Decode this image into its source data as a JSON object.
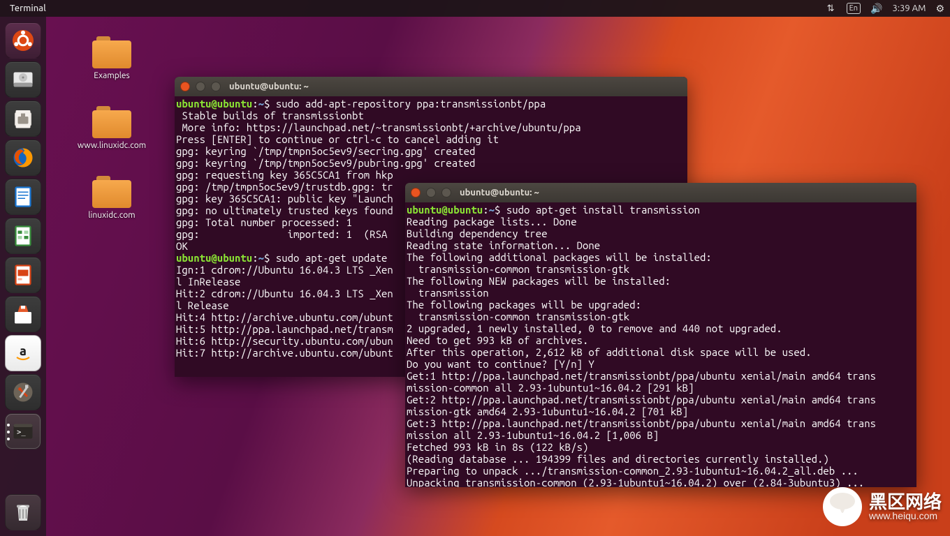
{
  "panel": {
    "app_title": "Terminal",
    "lang": "En",
    "time": "3:39 AM"
  },
  "desktop": {
    "icon1": "Examples",
    "icon2": "www.linuxidc.com",
    "icon3": "linuxidc.com"
  },
  "term1": {
    "title": "ubuntu@ubuntu: ~",
    "prompt_user": "ubuntu@ubuntu",
    "prompt_path": "~",
    "cmd1": "sudo add-apt-repository ppa:transmissionbt/ppa",
    "l1": " Stable builds of transmissionbt",
    "l2": " More info: https://launchpad.net/~transmissionbt/+archive/ubuntu/ppa",
    "l3": "Press [ENTER] to continue or ctrl-c to cancel adding it",
    "l4": "",
    "l5": "gpg: keyring `/tmp/tmpn5oc5ev9/secring.gpg' created",
    "l6": "gpg: keyring `/tmp/tmpn5oc5ev9/pubring.gpg' created",
    "l7": "gpg: requesting key 365C5CA1 from hkp",
    "l8": "gpg: /tmp/tmpn5oc5ev9/trustdb.gpg: tr",
    "l9": "gpg: key 365C5CA1: public key \"Launch",
    "l10": "gpg: no ultimately trusted keys found",
    "l11": "gpg: Total number processed: 1",
    "l12": "gpg:               imported: 1  (RSA",
    "l13": "OK",
    "cmd2": "sudo apt-get update",
    "l14": "Ign:1 cdrom://Ubuntu 16.04.3 LTS _Xen",
    "l15": "l InRelease",
    "l16": "Hit:2 cdrom://Ubuntu 16.04.3 LTS _Xen",
    "l17": "l Release",
    "l18": "Hit:4 http://archive.ubuntu.com/ubunt",
    "l19": "Hit:5 http://ppa.launchpad.net/transm",
    "l20": "Hit:6 http://security.ubuntu.com/ubun",
    "l21": "Hit:7 http://archive.ubuntu.com/ubunt"
  },
  "term2": {
    "title": "ubuntu@ubuntu: ~",
    "prompt_user": "ubuntu@ubuntu",
    "prompt_path": "~",
    "cmd1": "sudo apt-get install transmission",
    "l1": "Reading package lists... Done",
    "l2": "Building dependency tree       ",
    "l3": "Reading state information... Done",
    "l4": "The following additional packages will be installed:",
    "l5": "  transmission-common transmission-gtk",
    "l6": "The following NEW packages will be installed:",
    "l7": "  transmission",
    "l8": "The following packages will be upgraded:",
    "l9": "  transmission-common transmission-gtk",
    "l10": "2 upgraded, 1 newly installed, 0 to remove and 440 not upgraded.",
    "l11": "Need to get 993 kB of archives.",
    "l12": "After this operation, 2,612 kB of additional disk space will be used.",
    "l13": "Do you want to continue? [Y/n] Y",
    "l14": "Get:1 http://ppa.launchpad.net/transmissionbt/ppa/ubuntu xenial/main amd64 trans",
    "l15": "mission-common all 2.93-1ubuntu1~16.04.2 [291 kB]",
    "l16": "Get:2 http://ppa.launchpad.net/transmissionbt/ppa/ubuntu xenial/main amd64 trans",
    "l17": "mission-gtk amd64 2.93-1ubuntu1~16.04.2 [701 kB]",
    "l18": "Get:3 http://ppa.launchpad.net/transmissionbt/ppa/ubuntu xenial/main amd64 trans",
    "l19": "mission all 2.93-1ubuntu1~16.04.2 [1,006 B]",
    "l20": "Fetched 993 kB in 8s (122 kB/s)                                                 ",
    "l21": "(Reading database ... 194399 files and directories currently installed.)",
    "l22": "Preparing to unpack .../transmission-common_2.93-1ubuntu1~16.04.2_all.deb ...",
    "l23": "Unpacking transmission-common (2.93-1ubuntu1~16.04.2) over (2.84-3ubuntu3) ..."
  },
  "watermark": {
    "title": "黑区网络",
    "sub": "www.heiqu.com"
  }
}
